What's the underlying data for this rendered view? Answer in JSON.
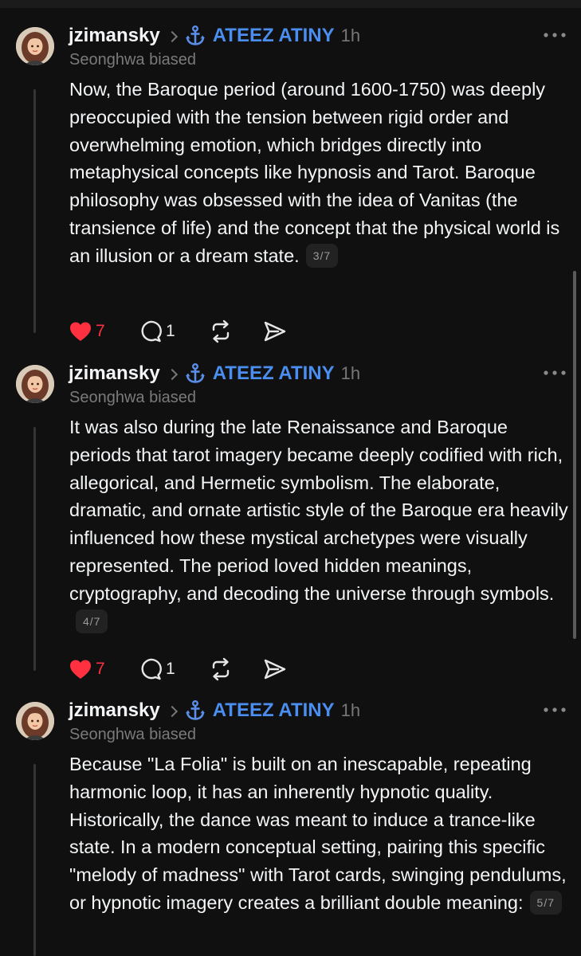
{
  "posts": [
    {
      "username": "jzimansky",
      "community": "ATEEZ ATINY",
      "time": "1h",
      "subtitle": "Seonghwa biased",
      "text": "Now, the Baroque period (around 1600-1750) was deeply preoccupied with the tension between rigid order and overwhelming emotion, which bridges directly into metaphysical concepts like hypnosis and Tarot. Baroque philosophy was obsessed with the idea of Vanitas (the transience of life) and the concept that the physical world is an illusion or a dream state.",
      "page": "3/7",
      "likes": "7",
      "replies": "1"
    },
    {
      "username": "jzimansky",
      "community": "ATEEZ ATINY",
      "time": "1h",
      "subtitle": "Seonghwa biased",
      "text": "It was also during the late Renaissance and Baroque periods that tarot imagery became deeply codified with rich, allegorical, and Hermetic symbolism. The elaborate, dramatic, and ornate artistic style of the Baroque era heavily influenced how these mystical archetypes were visually represented. The period loved hidden meanings, cryptography, and decoding the universe through symbols.",
      "page": "4/7",
      "likes": "7",
      "replies": "1"
    },
    {
      "username": "jzimansky",
      "community": "ATEEZ ATINY",
      "time": "1h",
      "subtitle": "Seonghwa biased",
      "text": "Because \"La Folia\" is built on an inescapable, repeating harmonic loop, it has an inherently hypnotic quality. Historically, the dance was meant to induce a trance-like state. In a modern conceptual setting, pairing this specific \"melody of madness\" with Tarot cards, swinging pendulums, or hypnotic imagery creates a brilliant double meaning:",
      "page": "5/7"
    }
  ],
  "icons": {
    "more": "more-options-icon",
    "anchor": "anchor-icon",
    "like": "heart-icon",
    "reply": "comment-icon",
    "repost": "repost-icon",
    "share": "send-icon"
  },
  "colors": {
    "background": "#101010",
    "community_link": "#4a8ef0",
    "like_active": "#ff3040",
    "secondary_text": "#777777"
  }
}
